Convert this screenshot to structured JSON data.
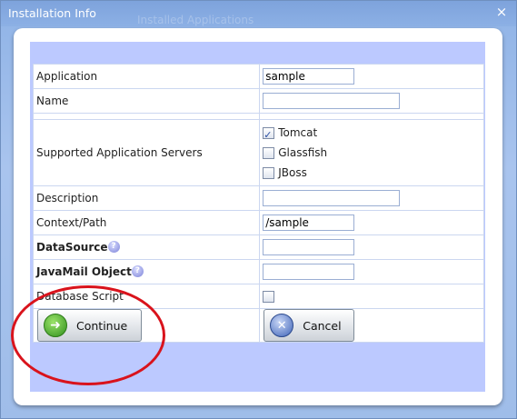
{
  "window": {
    "title": "Installation Info",
    "background_title": "Installed Applications"
  },
  "form": {
    "application": {
      "label": "Application",
      "value": "sample"
    },
    "name": {
      "label": "Name",
      "value": ""
    },
    "servers": {
      "label": "Supported Application Servers",
      "options": [
        {
          "label": "Tomcat",
          "checked": true
        },
        {
          "label": "Glassfish",
          "checked": false
        },
        {
          "label": "JBoss",
          "checked": false
        }
      ]
    },
    "description": {
      "label": "Description",
      "value": ""
    },
    "context_path": {
      "label": "Context/Path",
      "value": "/sample"
    },
    "datasource": {
      "label": "DataSource",
      "value": ""
    },
    "javamail": {
      "label": "JavaMail Object",
      "value": ""
    },
    "database_script": {
      "label": "Database Script",
      "checked": false
    }
  },
  "buttons": {
    "continue": "Continue",
    "cancel": "Cancel"
  },
  "help_glyph": "?",
  "colors": {
    "annotation": "#d9131c",
    "panel": "#bcc9ff",
    "titlebar": "#8cb0e5"
  }
}
